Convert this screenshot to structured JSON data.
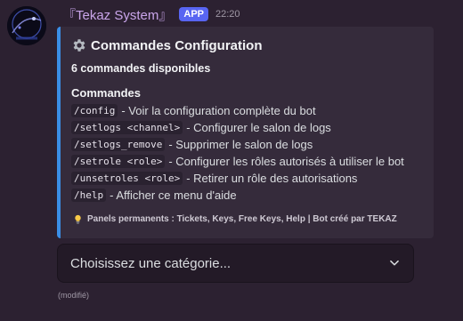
{
  "message": {
    "author": "『Tekaz System』",
    "badge": "APP",
    "timestamp": "22:20",
    "edited": "(modifié)"
  },
  "embed": {
    "accent_color": "#3a8ee6",
    "title_icon": "gear-icon",
    "title": "Commandes Configuration",
    "description": "6 commandes disponibles",
    "section_title": "Commandes",
    "commands": [
      {
        "cmd": "/config",
        "desc": "- Voir la configuration complète du bot"
      },
      {
        "cmd": "/setlogs <channel>",
        "desc": "- Configurer le salon de logs"
      },
      {
        "cmd": "/setlogs_remove",
        "desc": "- Supprimer le salon de logs"
      },
      {
        "cmd": "/setrole <role>",
        "desc": "- Configurer les rôles autorisés à utiliser le bot"
      },
      {
        "cmd": "/unsetroles <role>",
        "desc": "- Retirer un rôle des autorisations"
      },
      {
        "cmd": "/help",
        "desc": "- Afficher ce menu d'aide"
      }
    ],
    "footer_icon": "lightbulb-icon",
    "footer": "Panels permanents : Tickets, Keys, Free Keys, Help | Bot créé par TEKAZ"
  },
  "select_menu": {
    "placeholder": "Choisissez une catégorie..."
  }
}
